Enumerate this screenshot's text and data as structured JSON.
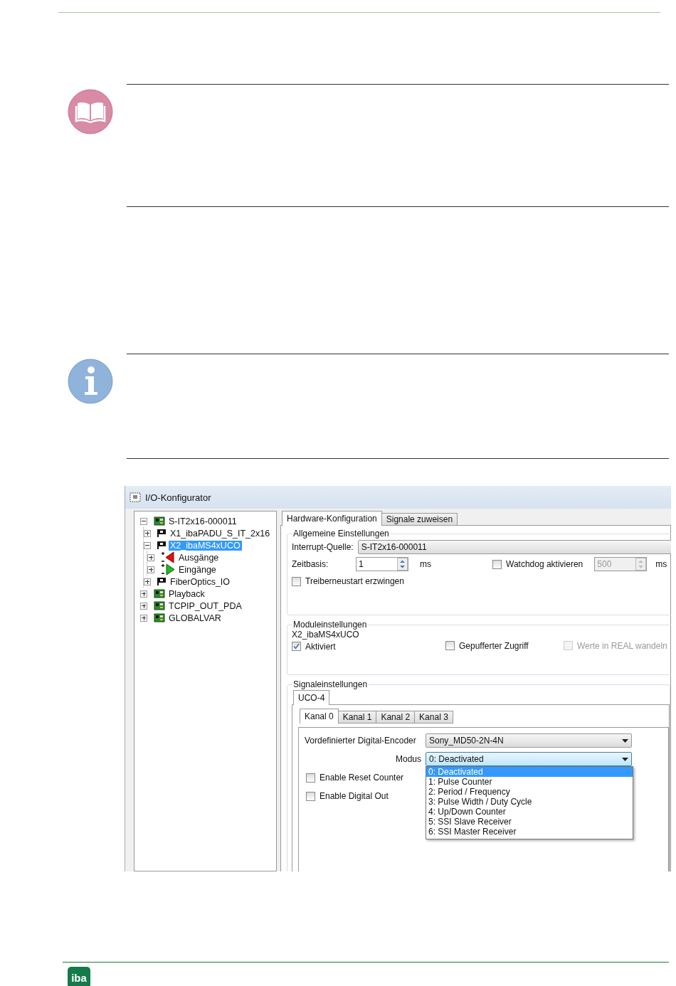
{
  "window": {
    "title": "I/O-Konfigurator"
  },
  "tree": [
    {
      "label": "S-IT2x16-000011",
      "kind": "device",
      "expanded": true,
      "selected": false,
      "children": [
        {
          "label": "X1_ibaPADU_S_IT_2x16",
          "kind": "module",
          "expanded": false,
          "selected": false
        },
        {
          "label": "X2_ibaMS4xUCO",
          "kind": "module",
          "expanded": true,
          "selected": true,
          "children": [
            {
              "label": "Ausgänge",
              "kind": "output",
              "expanded": false,
              "selected": false
            },
            {
              "label": "Eingänge",
              "kind": "input",
              "expanded": false,
              "selected": false
            }
          ]
        },
        {
          "label": "FiberOptics_IO",
          "kind": "module",
          "expanded": false,
          "selected": false
        }
      ]
    },
    {
      "label": "Playback",
      "kind": "device",
      "expanded": false,
      "selected": false
    },
    {
      "label": "TCPIP_OUT_PDA",
      "kind": "device",
      "expanded": false,
      "selected": false
    },
    {
      "label": "GLOBALVAR",
      "kind": "device",
      "expanded": false,
      "selected": false
    }
  ],
  "tabs": [
    {
      "label": "Hardware-Konfiguration",
      "selected": true
    },
    {
      "label": "Signale zuweisen",
      "selected": false
    }
  ],
  "general": {
    "title": "Allgemeine Einstellungen",
    "interrupt_label": "Interrupt-Quelle:",
    "interrupt_value": "S-IT2x16-000011",
    "timebase_label": "Zeitbasis:",
    "timebase_value": "1",
    "timebase_unit": "ms",
    "watchdog": {
      "label": "Watchdog aktivieren",
      "checked": false
    },
    "watchdog_field": {
      "value": "500",
      "disabled": true
    },
    "watchdog_unit": "ms",
    "restart": {
      "label": "Treiberneustart erzwingen",
      "checked": false
    }
  },
  "module": {
    "title": "Moduleinstellungen",
    "name": "X2_ibaMS4xUCO",
    "options": [
      {
        "label": "Aktiviert",
        "checked": true,
        "disabled": false
      },
      {
        "label": "Gepufferter Zugriff",
        "checked": false,
        "disabled": false
      },
      {
        "label": "Werte in REAL wandeln",
        "checked": false,
        "disabled": true
      }
    ]
  },
  "signals": {
    "title": "Signaleinstellungen",
    "tabs": [
      {
        "label": "UCO-4",
        "selected": true
      }
    ],
    "channel_tabs": [
      {
        "label": "Kanal 0",
        "selected": true
      },
      {
        "label": "Kanal 1",
        "selected": false
      },
      {
        "label": "Kanal 2",
        "selected": false
      },
      {
        "label": "Kanal 3",
        "selected": false
      }
    ],
    "encoder_label": "Vordefinierter Digital-Encoder",
    "encoder_value": "Sony_MD50-2N-4N",
    "mode_label": "Modus",
    "mode_value": "0: Deactivated",
    "mode_open": true,
    "mode_options": [
      {
        "label": "0: Deactivated",
        "selected": true
      },
      {
        "label": "1: Pulse Counter",
        "selected": false
      },
      {
        "label": "2: Period / Frequency",
        "selected": false
      },
      {
        "label": "3: Pulse Width / Duty Cycle",
        "selected": false
      },
      {
        "label": "4: Up/Down Counter",
        "selected": false
      },
      {
        "label": "5: SSI Slave Receiver",
        "selected": false
      },
      {
        "label": "6: SSI Master Receiver",
        "selected": false
      }
    ],
    "options": [
      {
        "label": "Enable Reset Counter",
        "checked": false
      },
      {
        "label": "Enable Digital Out",
        "checked": false
      }
    ]
  },
  "footer": {
    "logo": "iba"
  }
}
